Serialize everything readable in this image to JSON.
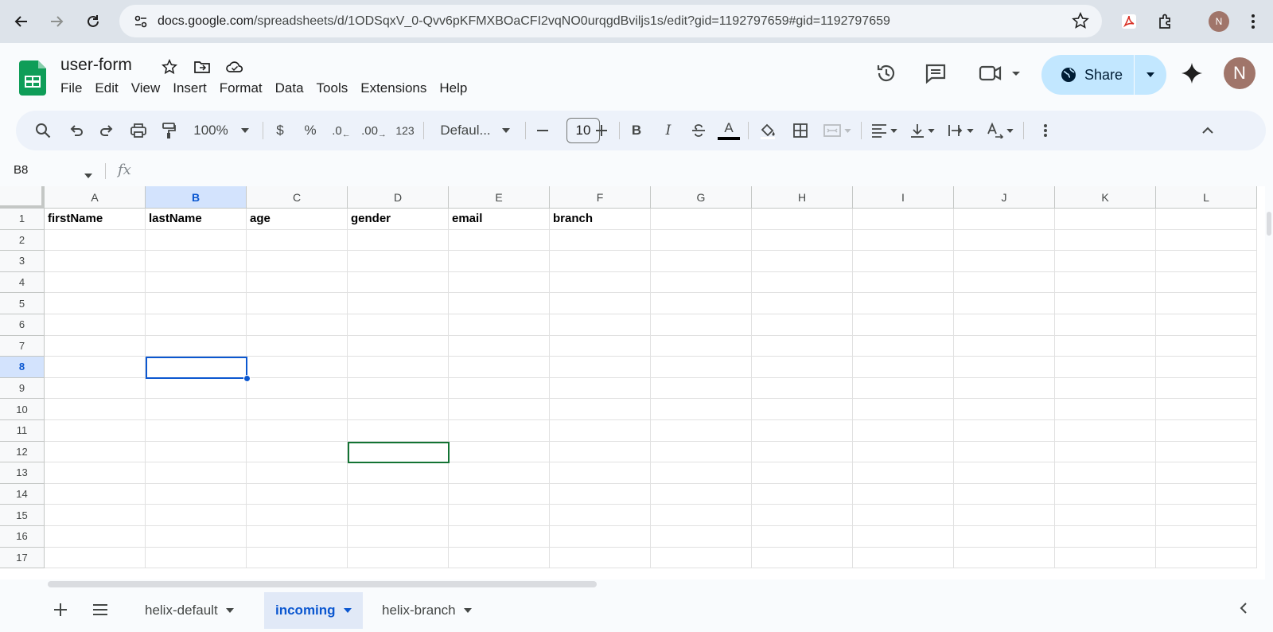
{
  "browser": {
    "url_host": "docs.google.com",
    "url_path": "/spreadsheets/d/1ODSqxV_0-Qvv6pKFMXBOaCFI2vqNO0urqgdBviljs1s/edit?gid=1192797659#gid=1192797659",
    "profile_initial": "N"
  },
  "doc": {
    "title": "user-form",
    "menu": [
      "File",
      "Edit",
      "View",
      "Insert",
      "Format",
      "Data",
      "Tools",
      "Extensions",
      "Help"
    ],
    "share_label": "Share",
    "avatar_initial": "N"
  },
  "toolbar": {
    "zoom": "100%",
    "currency": "$",
    "percent": "%",
    "dec_decrease": ".0",
    "dec_increase": ".00",
    "number_format": "123",
    "font": "Defaul...",
    "font_size": "10",
    "bold": "B",
    "italic": "I",
    "text_color": "A"
  },
  "formula_bar": {
    "cell_ref": "B8",
    "fx_label": "fx"
  },
  "grid": {
    "columns": [
      "A",
      "B",
      "C",
      "D",
      "E",
      "F",
      "G",
      "H",
      "I",
      "J",
      "K",
      "L"
    ],
    "rows": [
      "1",
      "2",
      "3",
      "4",
      "5",
      "6",
      "7",
      "8",
      "9",
      "10",
      "11",
      "12",
      "13",
      "14",
      "15",
      "16",
      "17"
    ],
    "selected_cell": "B8",
    "header_row": [
      "firstName",
      "lastName",
      "age",
      "gender",
      "email",
      "branch"
    ]
  },
  "sheets": {
    "tabs": [
      "helix-default",
      "incoming",
      "helix-branch"
    ],
    "active": "incoming"
  },
  "colors": {
    "accent": "#0b57d0",
    "sheets_green": "#0f9d58",
    "share_bg": "#c2e7ff",
    "collaborator_cursor": "#137333"
  }
}
